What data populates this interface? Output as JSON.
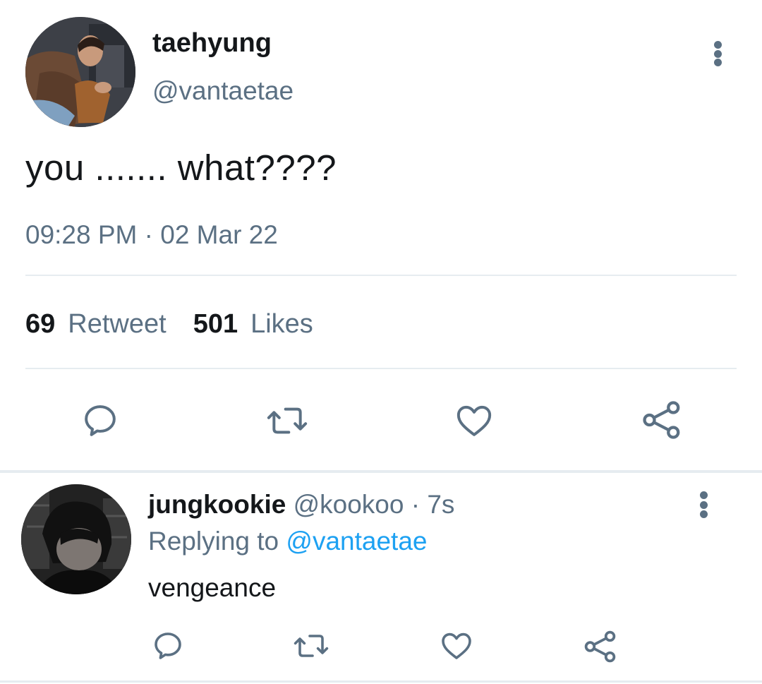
{
  "main_tweet": {
    "author_name": "taehyung",
    "author_handle": "@vantaetae",
    "text": "you ....... what????",
    "timestamp": "09:28 PM · 02 Mar 22",
    "retweet_count": "69",
    "retweet_label": "Retweet",
    "like_count": "501",
    "like_label": "Likes",
    "avatar_icon": "profile-photo-icon",
    "more_icon": "more-vertical-icon",
    "actions": [
      "reply-icon",
      "retweet-icon",
      "like-icon",
      "share-icon"
    ]
  },
  "reply": {
    "author_name": "jungkookie",
    "author_handle": "@kookoo",
    "time_sep": " · ",
    "time": "7s",
    "replying_prefix": "Replying to ",
    "replying_to": "@vantaetae",
    "text": "vengeance",
    "avatar_icon": "profile-photo-icon",
    "more_icon": "more-vertical-icon",
    "actions": [
      "reply-icon",
      "retweet-icon",
      "like-icon",
      "share-icon"
    ]
  },
  "colors": {
    "text_primary": "#14171a",
    "text_secondary": "#5b7083",
    "link": "#1da1f2",
    "divider": "#e6ecf0"
  }
}
